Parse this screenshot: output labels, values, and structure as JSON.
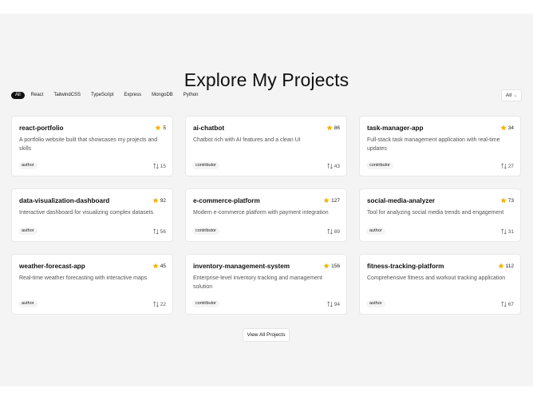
{
  "header": {
    "title": "Explore My Projects"
  },
  "filters": {
    "tags": [
      "All",
      "React",
      "TailwindCSS",
      "TypeScript",
      "Express",
      "MongoDB",
      "Python"
    ],
    "active": "All"
  },
  "sort": {
    "value": "All"
  },
  "projects": [
    {
      "name": "react-portfolio",
      "stars": "5",
      "description": "A portfolio website built that showcases my projects and skills",
      "role": "author",
      "forks": "15"
    },
    {
      "name": "ai-chatbot",
      "stars": "86",
      "description": "Chatbot rich with AI features and a clean UI",
      "role": "contributor",
      "forks": "43"
    },
    {
      "name": "task-manager-app",
      "stars": "34",
      "description": "Full-stack task management application with real-time updates",
      "role": "contributor",
      "forks": "27"
    },
    {
      "name": "data-visualization-dashboard",
      "stars": "92",
      "description": "Interactive dashboard for visualizing complex datasets",
      "role": "author",
      "forks": "56"
    },
    {
      "name": "e-commerce-platform",
      "stars": "127",
      "description": "Modern e-commerce platform with payment integration",
      "role": "contributor",
      "forks": "89"
    },
    {
      "name": "social-media-analyzer",
      "stars": "73",
      "description": "Tool for analyzing social media trends and engagement",
      "role": "author",
      "forks": "31"
    },
    {
      "name": "weather-forecast-app",
      "stars": "45",
      "description": "Real-time weather forecasting with interactive maps",
      "role": "author",
      "forks": "22"
    },
    {
      "name": "inventory-management-system",
      "stars": "156",
      "description": "Enterprise-level inventory tracking and management solution",
      "role": "contributor",
      "forks": "94"
    },
    {
      "name": "fitness-tracking-platform",
      "stars": "112",
      "description": "Comprehensive fitness and workout tracking application",
      "role": "author",
      "forks": "67"
    }
  ],
  "footer": {
    "view_all_label": "View All Projects"
  },
  "colors": {
    "star": "#f5b400",
    "active_chip": "#111111",
    "background": "#f4f4f5"
  },
  "icons": {
    "star": "star-icon",
    "fork": "fork-icon",
    "chevron": "chevron-down-icon"
  }
}
